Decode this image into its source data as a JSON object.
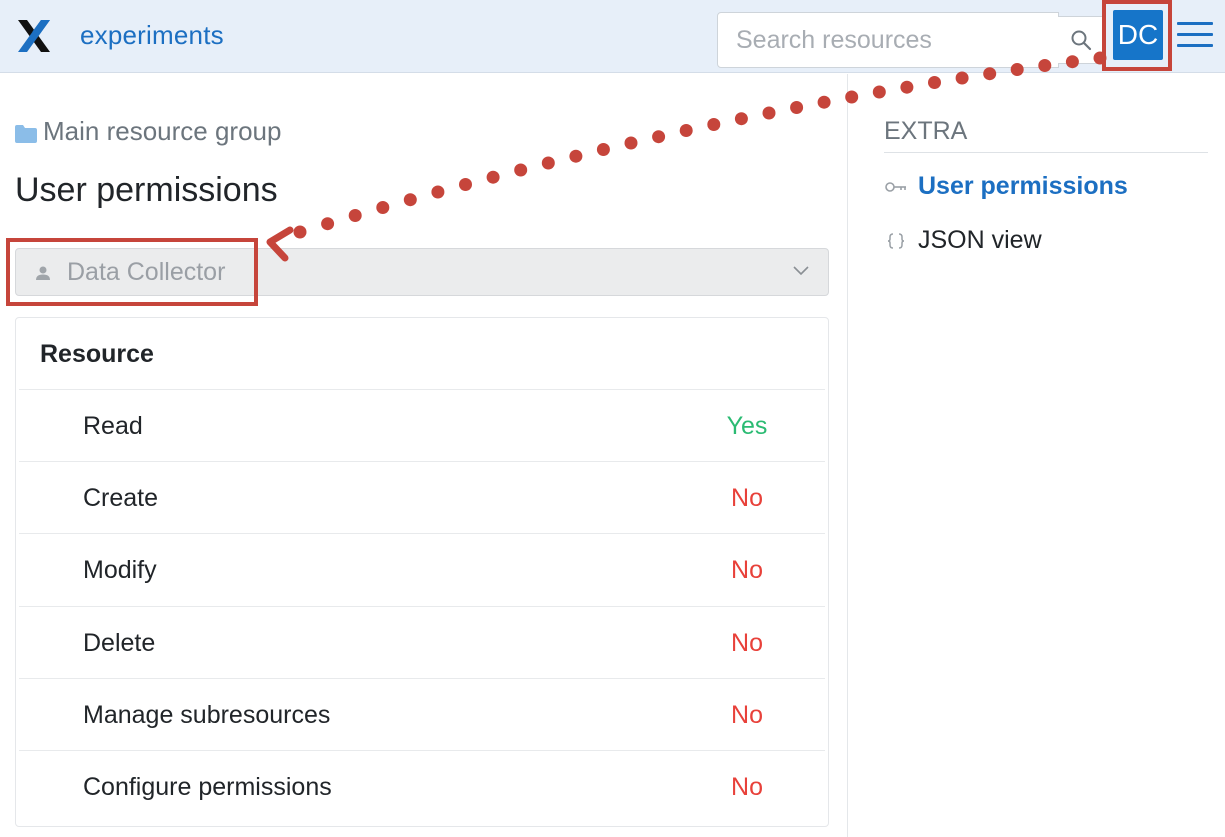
{
  "header": {
    "app_title": "experiments",
    "search_placeholder": "Search resources",
    "avatar_initials": "DC"
  },
  "breadcrumb": {
    "label": "Main resource group"
  },
  "page_title": "User permissions",
  "role_select": {
    "selected": "Data Collector"
  },
  "permissions": {
    "header": "Resource",
    "rows": [
      {
        "label": "Read",
        "value": "Yes"
      },
      {
        "label": "Create",
        "value": "No"
      },
      {
        "label": "Modify",
        "value": "No"
      },
      {
        "label": "Delete",
        "value": "No"
      },
      {
        "label": "Manage subresources",
        "value": "No"
      },
      {
        "label": "Configure permissions",
        "value": "No"
      }
    ]
  },
  "sidebar": {
    "heading": "EXTRA",
    "items": [
      {
        "label": "User permissions",
        "icon": "key-icon",
        "active": true
      },
      {
        "label": "JSON view",
        "icon": "braces-icon",
        "active": false
      }
    ]
  },
  "colors": {
    "brand": "#1c6fc2",
    "yes": "#2bbb73",
    "no": "#e8413a",
    "annotation": "#c6453b"
  }
}
